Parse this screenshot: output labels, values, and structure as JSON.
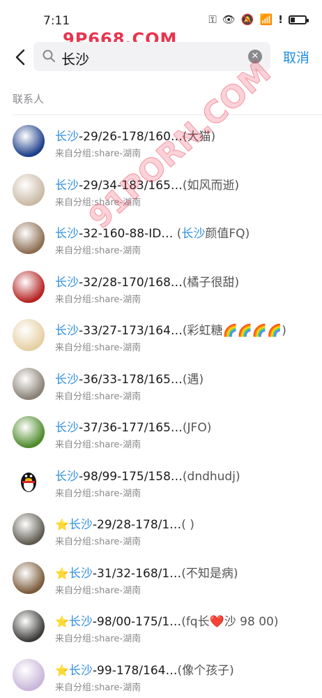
{
  "status": {
    "time": "7:11",
    "icons": [
      "key-icon",
      "eye-icon",
      "bell-muted-icon",
      "wifi-icon",
      "alert-icon",
      "battery-icon"
    ],
    "battery_level": 0.3
  },
  "watermark": {
    "top": "9P668.COM",
    "diagonal": "91PORN.COM"
  },
  "search": {
    "query_keyword": "长沙",
    "cancel_label": "取消"
  },
  "section": {
    "label": "联系人"
  },
  "contacts": [
    {
      "star": "",
      "keyword": "长沙",
      "name_rest": "-29/26-178/160…",
      "nick": "(大猫)",
      "group": "来自分组:share-湖南",
      "avatar_color": "#1c3e8a"
    },
    {
      "star": "",
      "keyword": "长沙",
      "name_rest": "-29/34-183/165…",
      "nick": "(如风而逝)",
      "group": "来自分组:share-湖南",
      "avatar_color": "#c9b9a4"
    },
    {
      "star": "",
      "keyword": "长沙",
      "name_rest": "-32-160-88-ID…",
      "nick_prefix": " (",
      "nick_keyword": "长沙",
      "nick_rest": "颜值FQ)",
      "group": "来自分组:share-湖南",
      "avatar_color": "#8c6c50"
    },
    {
      "star": "",
      "keyword": "长沙",
      "name_rest": "-32/28-170/168…",
      "nick": "(橘子很甜)",
      "group": "来自分组:share-湖南",
      "avatar_color": "#b52222"
    },
    {
      "star": "",
      "keyword": "长沙",
      "name_rest": "-33/27-173/164…",
      "nick": "(彩虹糖🌈🌈🌈🌈)",
      "group": "来自分组:share-湖南",
      "avatar_color": "#e6cfa3"
    },
    {
      "star": "",
      "keyword": "长沙",
      "name_rest": "-36/33-178/165…",
      "nick": "(遇)",
      "group": "来自分组:share-湖南",
      "avatar_color": "#8a8176"
    },
    {
      "star": "",
      "keyword": "长沙",
      "name_rest": "-37/36-177/165…",
      "nick": "(JFO)",
      "group": "来自分组:share-湖南",
      "avatar_color": "#4d8a2a"
    },
    {
      "star": "",
      "keyword": "长沙",
      "name_rest": "-98/99-175/158…",
      "nick": "(dndhudj)",
      "group": "来自分组:share-湖南",
      "avatar_color": "#ffffff"
    },
    {
      "star": "⭐",
      "keyword": "长沙",
      "name_rest": "-29/28-178/1…",
      "nick": "( )",
      "group": "来自分组:share-湖南",
      "avatar_color": "#5e5a50"
    },
    {
      "star": "⭐",
      "keyword": "长沙",
      "name_rest": "-31/32-168/1…",
      "nick": "(不知是病)",
      "group": "来自分组:share-湖南",
      "avatar_color": "#7a5a3a"
    },
    {
      "star": "⭐",
      "keyword": "长沙",
      "name_rest": "-98/00-175/1…",
      "nick": "(fq长❤️沙 98 00)",
      "group": "来自分组:share-湖南",
      "avatar_color": "#3b3a38"
    },
    {
      "star": "⭐",
      "keyword": "长沙",
      "name_rest": "-99-178/164…",
      "nick": "(像个孩子)",
      "group": "来自分组:share-湖南",
      "avatar_color": "#c9b6d9"
    }
  ]
}
